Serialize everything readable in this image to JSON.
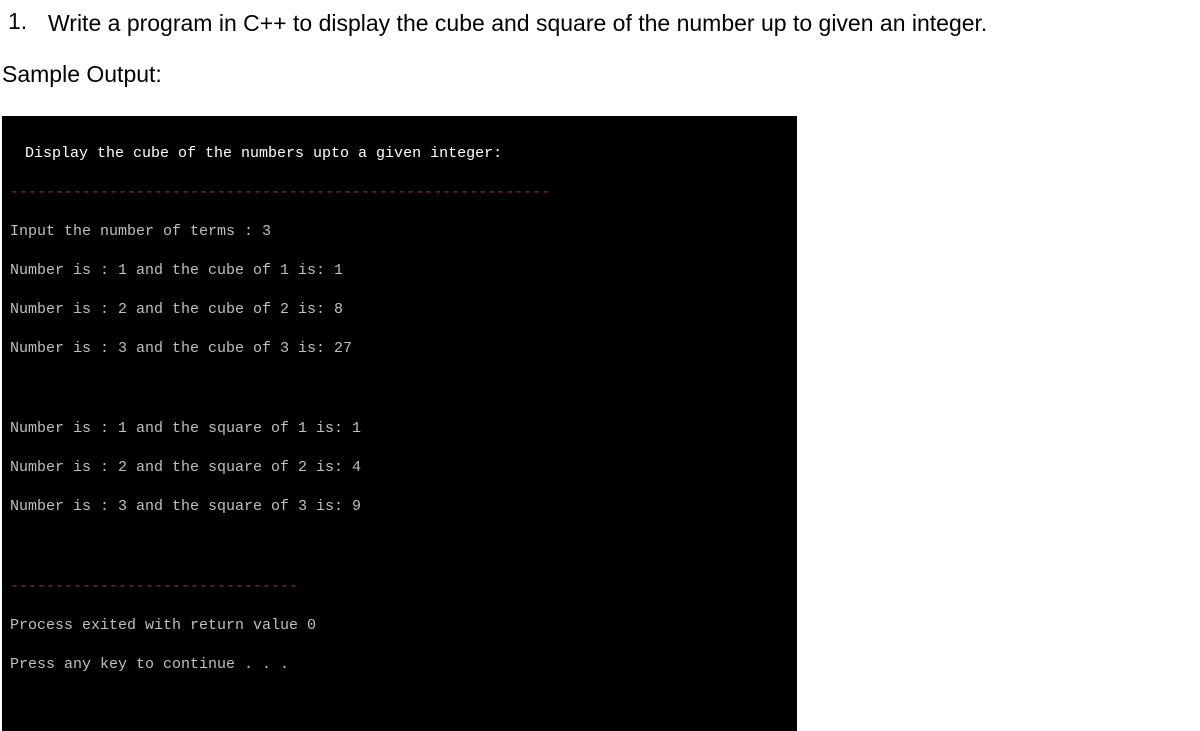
{
  "question": {
    "number": "1.",
    "text": "Write a program in C++ to display the cube and square of the number up to given an integer."
  },
  "sample_output_label": "Sample Output:",
  "terminal": {
    "title": " Display the cube of the numbers upto a given integer:",
    "divider1": "------------------------------------------------------------",
    "input_line": "Input the number of terms : 3",
    "cube_lines": [
      "Number is : 1 and the cube of 1 is: 1",
      "Number is : 2 and the cube of 2 is: 8",
      "Number is : 3 and the cube of 3 is: 27"
    ],
    "square_lines": [
      "Number is : 1 and the square of 1 is: 1",
      "Number is : 2 and the square of 2 is: 4",
      "Number is : 3 and the square of 3 is: 9"
    ],
    "divider2": "--------------------------------",
    "exit_line": "Process exited with return value 0",
    "continue_line": "Press any key to continue . . ."
  }
}
